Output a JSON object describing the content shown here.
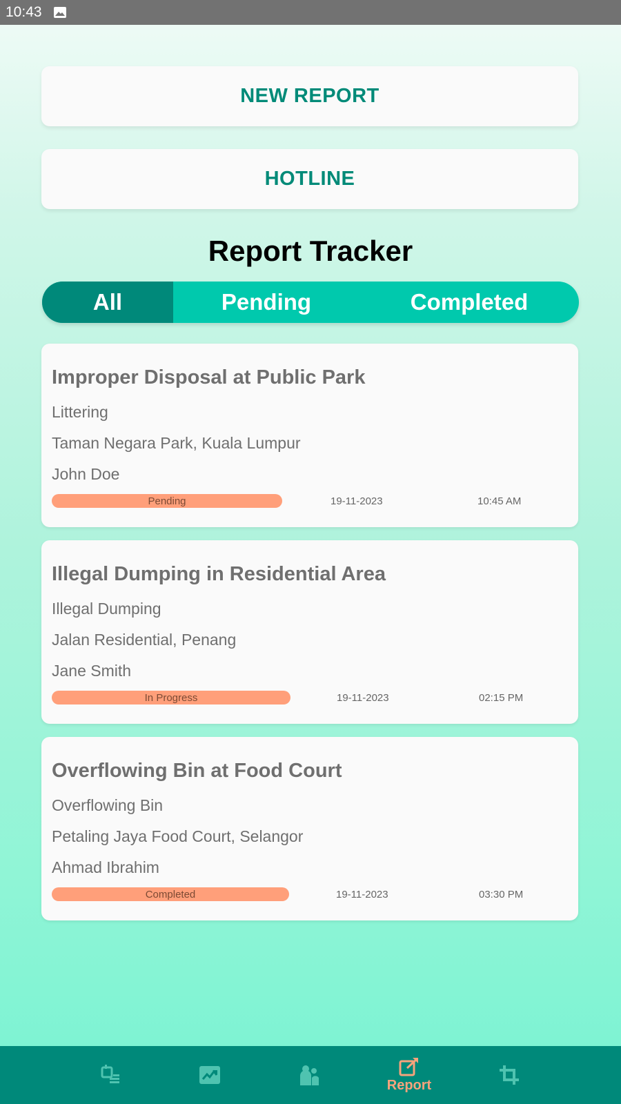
{
  "status_bar": {
    "time": "10:43"
  },
  "actions": {
    "new_report": "NEW REPORT",
    "hotline": "HOTLINE"
  },
  "tracker": {
    "title": "Report Tracker",
    "tabs": [
      "All",
      "Pending",
      "Completed"
    ],
    "selected_tab": "All"
  },
  "reports": [
    {
      "title": "Improper Disposal at Public Park",
      "category": "Littering",
      "location": "Taman Negara Park, Kuala Lumpur",
      "reporter": "John Doe",
      "status": "Pending",
      "date": "19-11-2023",
      "time": "10:45 AM"
    },
    {
      "title": "Illegal Dumping in Residential Area",
      "category": "Illegal Dumping",
      "location": "Jalan Residential, Penang",
      "reporter": "Jane Smith",
      "status": "In Progress",
      "date": "19-11-2023",
      "time": "02:15 PM"
    },
    {
      "title": "Overflowing Bin at Food Court",
      "category": "Overflowing Bin",
      "location": "Petaling Jaya Food Court, Selangor",
      "reporter": "Ahmad Ibrahim",
      "status": "Completed",
      "date": "19-11-2023",
      "time": "03:30 PM"
    }
  ],
  "bottom_nav": {
    "items": [
      {
        "icon": "schedule-list-icon",
        "label": ""
      },
      {
        "icon": "photo-icon",
        "label": ""
      },
      {
        "icon": "people-icon",
        "label": ""
      },
      {
        "icon": "report-edit-icon",
        "label": "Report",
        "active": true
      },
      {
        "icon": "crop-icon",
        "label": ""
      }
    ]
  },
  "colors": {
    "accent": "#008a78",
    "tab_bar": "#00c9ad",
    "tab_selected": "#00897a",
    "status_pill": "#ff9f7a",
    "nav_active": "#f7a37c"
  }
}
